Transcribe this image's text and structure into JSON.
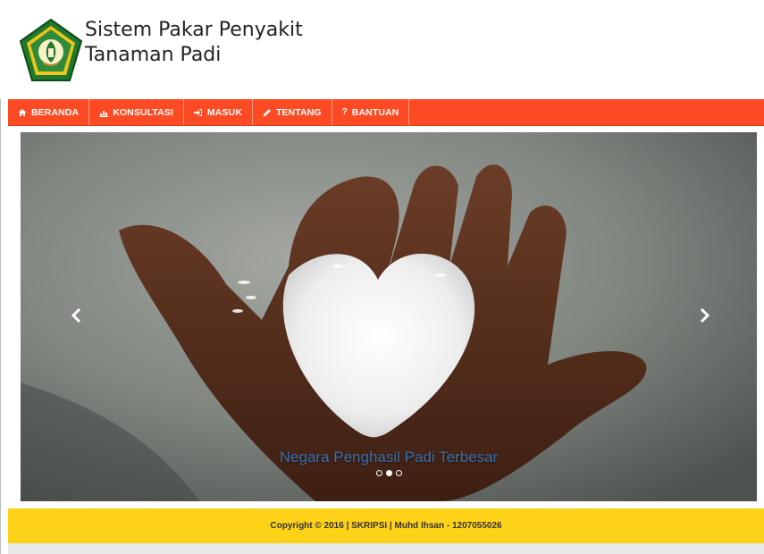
{
  "header": {
    "title_line1": "Sistem Pakar Penyakit",
    "title_line2": "Tanaman Padi"
  },
  "nav": {
    "items": [
      {
        "label": "BERANDA",
        "icon": "home-icon"
      },
      {
        "label": "KONSULTASI",
        "icon": "bar-chart-icon"
      },
      {
        "label": "MASUK",
        "icon": "sign-in-icon"
      },
      {
        "label": "TENTANG",
        "icon": "pencil-icon"
      },
      {
        "label": "BANTUAN",
        "icon": "question-icon"
      }
    ]
  },
  "carousel": {
    "caption": "Negara Penghasil Padi Terbesar",
    "prev_icon": "chevron-left-icon",
    "next_icon": "chevron-right-icon",
    "slide_count": 3,
    "active_index": 1
  },
  "footer": {
    "text": "Copyright © 2016 | SKRIPSI | Muhd Ihsan - 1207055026"
  },
  "colors": {
    "navbar": "#fc4b24",
    "footer": "#fed219",
    "caption": "#3a6fb0"
  }
}
